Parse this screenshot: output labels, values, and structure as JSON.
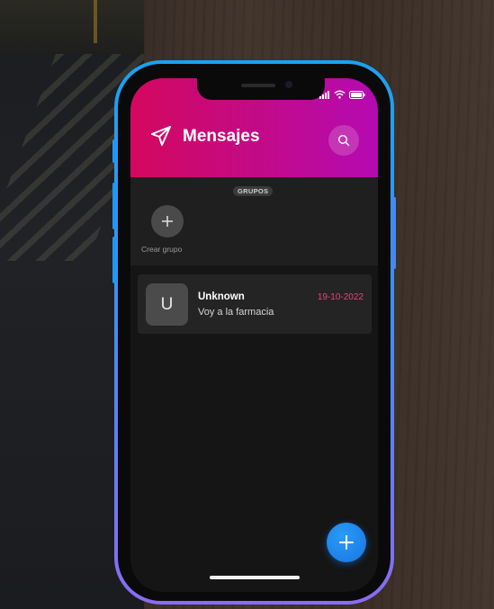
{
  "header": {
    "title": "Mensajes"
  },
  "groups": {
    "badge": "GRUPOS",
    "create_label": "Crear grupo"
  },
  "messages": [
    {
      "avatar_letter": "U",
      "contact": "Unknown",
      "date": "19-10-2022",
      "preview": "Voy a la farmacia"
    }
  ],
  "icons": {
    "send": "paper-plane-icon",
    "search": "search-icon",
    "add_group": "plus-icon",
    "fab": "plus-icon"
  },
  "colors": {
    "header_start": "#d4085e",
    "header_end": "#b40ab2",
    "date": "#e0457f",
    "fab": "#1774e3",
    "frame_top": "#1aa2f0",
    "frame_bottom": "#8a6cf2"
  }
}
